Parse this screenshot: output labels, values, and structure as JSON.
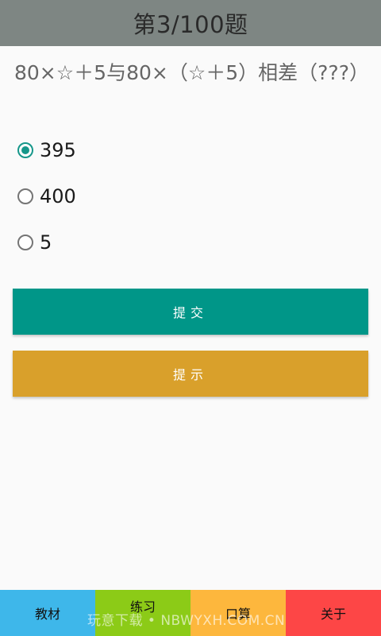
{
  "header": {
    "title": "第3/100题"
  },
  "question": {
    "text": "80×☆＋5与80×（☆＋5）相差（???）"
  },
  "options": [
    {
      "label": "395",
      "checked": true
    },
    {
      "label": "400",
      "checked": false
    },
    {
      "label": "5",
      "checked": false
    }
  ],
  "buttons": {
    "submit_label": "提交",
    "hint_label": "提示"
  },
  "bottom_nav": {
    "items": [
      {
        "label": "教材",
        "color": "#3eb7ea"
      },
      {
        "label": "练习",
        "color": "#8ccb17",
        "active": true
      },
      {
        "label": "口算",
        "color": "#fdb73d"
      },
      {
        "label": "关于",
        "color": "#fd4646"
      }
    ]
  },
  "watermark": "玩意下载 • NBWYXH.COM.CN",
  "colors": {
    "header": "#7e8683",
    "accent": "#009688",
    "hint": "#d9a02b"
  }
}
